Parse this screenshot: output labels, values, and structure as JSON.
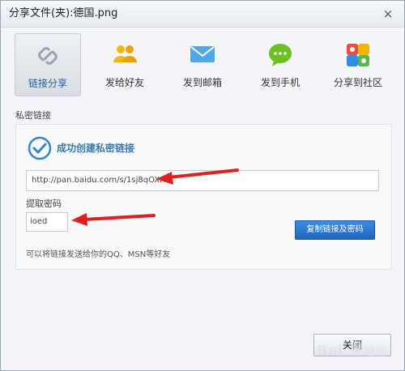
{
  "window": {
    "title": "分享文件(夹):德国.png",
    "close_label": "×"
  },
  "tabs": [
    {
      "label": "链接分享",
      "icon": "link-icon",
      "active": true
    },
    {
      "label": "发给好友",
      "icon": "friends-icon",
      "active": false
    },
    {
      "label": "发到邮箱",
      "icon": "mail-icon",
      "active": false
    },
    {
      "label": "发到手机",
      "icon": "chat-icon",
      "active": false
    },
    {
      "label": "分享到社区",
      "icon": "community-icon",
      "active": false
    }
  ],
  "section_title": "私密链接",
  "panel": {
    "success_text": "成功创建私密链接",
    "link_value": "http://pan.baidu.com/s/1sj8qOXn",
    "code_label": "提取密码",
    "code_value": "ioed",
    "copy_button": "复制链接及密码",
    "hint": "可以将链接发送给你的QQ、MSN等好友"
  },
  "footer": {
    "close_button": "关闭"
  },
  "colors": {
    "accent": "#1f67c2",
    "arrow": "#e02020",
    "success": "#3a7bb6"
  }
}
